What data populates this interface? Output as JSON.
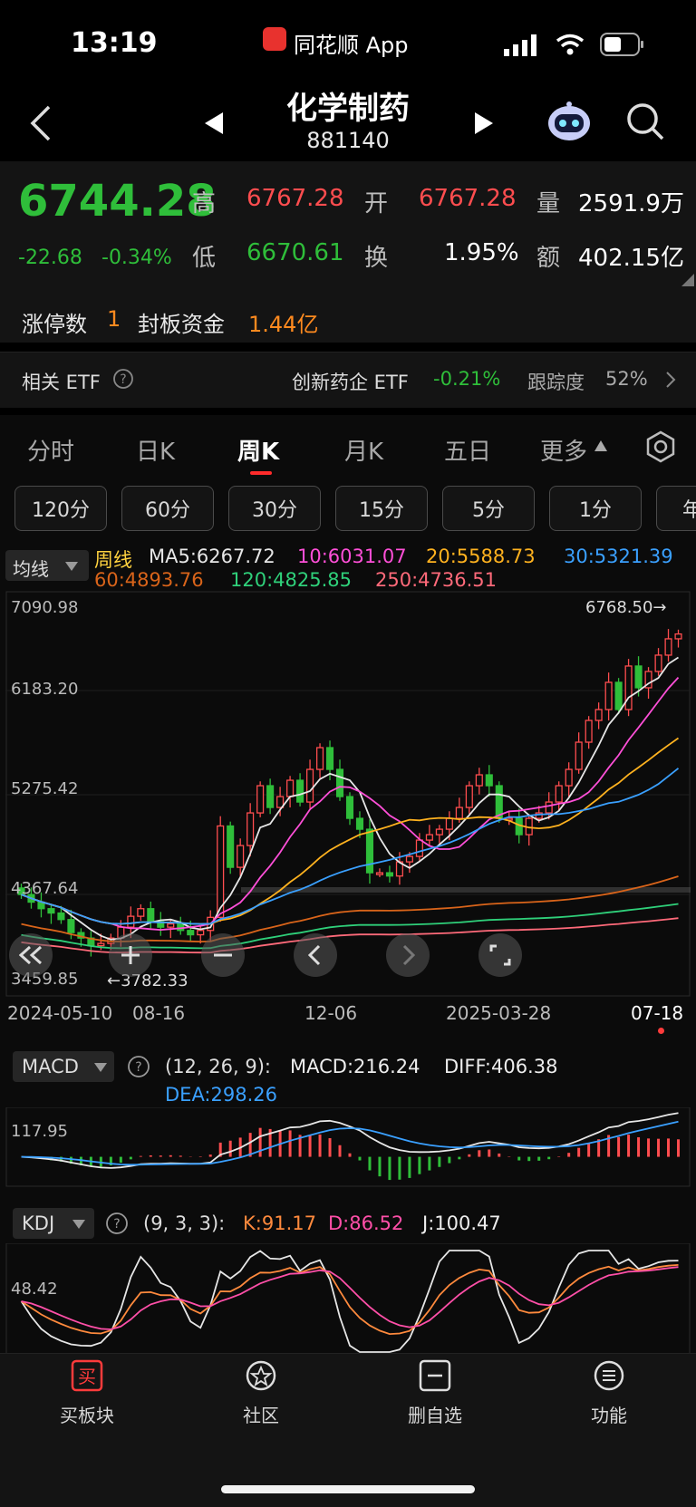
{
  "status": {
    "time": "13:19",
    "app_label": "同花顺 App"
  },
  "nav": {
    "title": "化学制药",
    "code": "881140"
  },
  "quote": {
    "price": "6744.28",
    "change": "-22.68",
    "change_pct": "-0.34%",
    "high_label": "高",
    "high": "6767.28",
    "open_label": "开",
    "open": "6767.28",
    "volume_label": "量",
    "volume": "2591.9万",
    "low_label": "低",
    "low": "6670.61",
    "turnover_label": "换",
    "turnover": "1.95%",
    "amount_label": "额",
    "amount": "402.15亿"
  },
  "limit": {
    "count_label": "涨停数",
    "count": "1",
    "fund_label": "封板资金",
    "fund": "1.44亿"
  },
  "etf": {
    "label": "相关 ETF",
    "name": "创新药企 ETF",
    "change": "-0.21%",
    "track_label": "跟踪度",
    "track": "52%"
  },
  "tabs": [
    "分时",
    "日K",
    "周K",
    "月K",
    "五日",
    "更多"
  ],
  "active_tab": "周K",
  "periods": [
    "120分",
    "60分",
    "30分",
    "15分",
    "5分",
    "1分",
    "年"
  ],
  "ma": {
    "selector": "均线",
    "period": "周线",
    "ma5": "MA5:6267.72",
    "ma10": "10:6031.07",
    "ma20": "20:5588.73",
    "ma30": "30:5321.39",
    "ma60": "60:4893.76",
    "ma120": "120:4825.85",
    "ma250": "250:4736.51"
  },
  "chart_data": {
    "type": "candlestick",
    "y_ticks": [
      "7090.98",
      "6183.20",
      "5275.42",
      "4367.64",
      "3459.85"
    ],
    "x_ticks": [
      "2024-05-10",
      "08-16",
      "12-06",
      "2025-03-28",
      "07-18"
    ],
    "max_label": "6768.50→",
    "min_label": "←3782.33",
    "ylim": [
      3459.85,
      7090.98
    ],
    "closes": [
      4350,
      4280,
      4220,
      4180,
      4120,
      4000,
      3950,
      3880,
      3900,
      3950,
      4050,
      4150,
      4220,
      4100,
      4050,
      4080,
      4020,
      3980,
      4020,
      4140,
      4980,
      4600,
      4800,
      5100,
      5350,
      5150,
      5250,
      5400,
      5200,
      5500,
      5700,
      5500,
      5250,
      5050,
      4950,
      4550,
      4550,
      4520,
      4650,
      4700,
      4850,
      4900,
      4950,
      5050,
      5150,
      5350,
      5450,
      5350,
      5050,
      5050,
      4900,
      5050,
      5100,
      5200,
      5350,
      5500,
      5750,
      5950,
      6050,
      6300,
      6050,
      6450,
      6250,
      6400,
      6550,
      6700,
      6744.28
    ],
    "macd": {
      "label": "MACD",
      "params": "(12, 26, 9):",
      "macd": "MACD:216.24",
      "diff": "DIFF:406.38",
      "dea": "DEA:298.26",
      "tick": "117.95"
    },
    "kdj": {
      "label": "KDJ",
      "params": "(9, 3, 3):",
      "k": "K:91.17",
      "d": "D:86.52",
      "j": "J:100.47",
      "tick": "48.42"
    }
  },
  "tabbar": [
    {
      "icon": "buy-icon",
      "label": "买板块"
    },
    {
      "icon": "community-icon",
      "label": "社区"
    },
    {
      "icon": "remove-watchlist-icon",
      "label": "删自选"
    },
    {
      "icon": "menu-icon",
      "label": "功能"
    }
  ],
  "colors": {
    "up": "#ff4d4f",
    "down": "#2fbe3a",
    "accent": "#ff8a1f",
    "tab_active": "#ff2b2b"
  }
}
